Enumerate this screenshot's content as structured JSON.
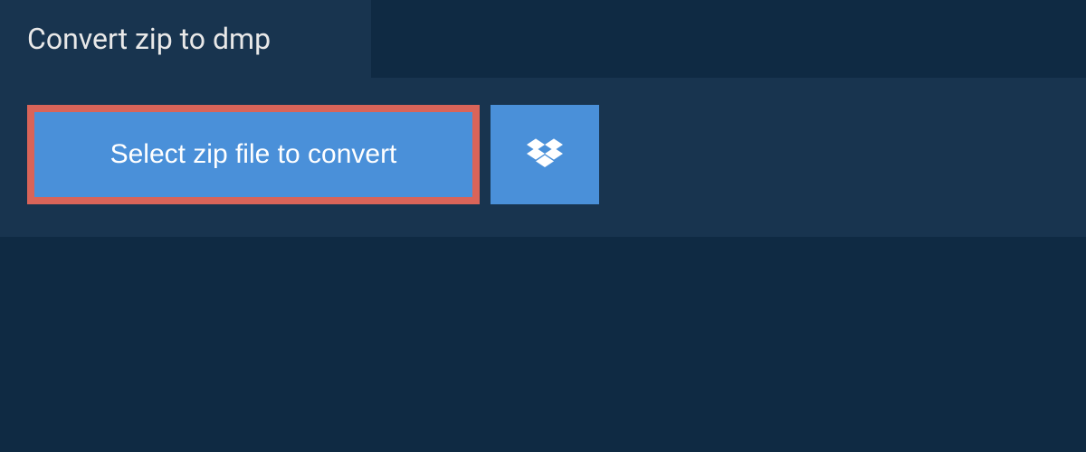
{
  "header": {
    "title": "Convert zip to dmp"
  },
  "actions": {
    "select_file_label": "Select zip file to convert"
  }
}
